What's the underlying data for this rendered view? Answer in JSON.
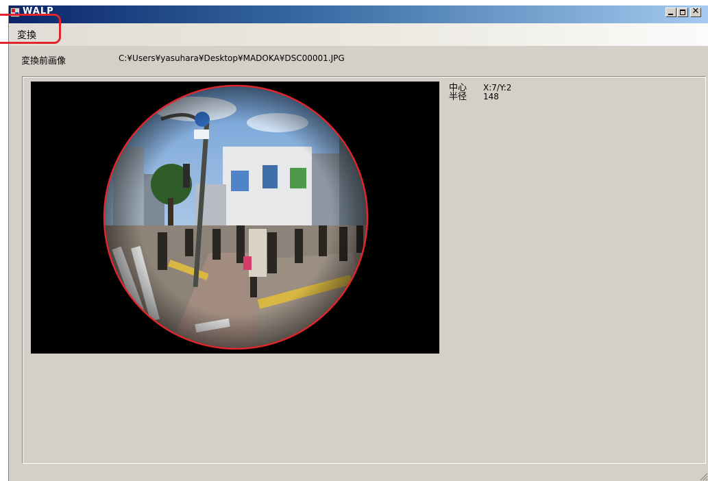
{
  "window": {
    "title": "WALP"
  },
  "menu": {
    "convert_label": "変換"
  },
  "source": {
    "label": "変換前画像",
    "path": "C:¥Users¥yasuhara¥Desktop¥MADOKA¥DSC00001.JPG"
  },
  "info": {
    "center_label": "中心",
    "center_value": "X:7/Y:2",
    "radius_label": "半径",
    "radius_value": "148"
  },
  "colors": {
    "highlight": "#e0262c",
    "circle_outline": "#e0262c",
    "window_bg": "#d4d0c8"
  },
  "icons": {
    "app": "app-icon",
    "minimize": "minimize-icon",
    "maximize": "maximize-icon",
    "close": "close-icon",
    "grip": "size-grip-icon"
  }
}
